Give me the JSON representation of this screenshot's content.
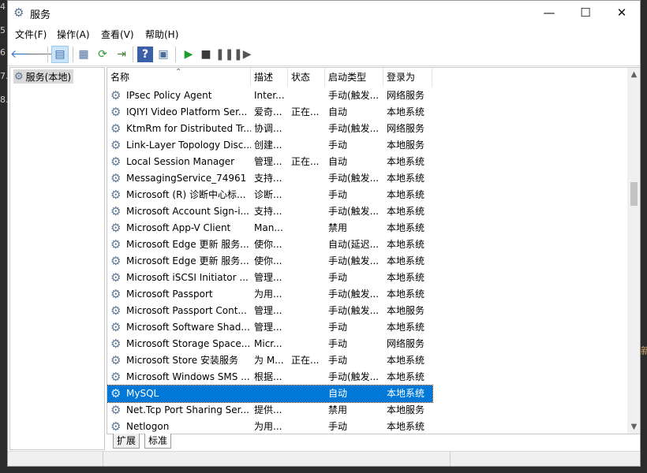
{
  "gutter": [
    "4",
    "5",
    "6",
    "7.",
    "8."
  ],
  "right_edge_char": "新",
  "window": {
    "title": "服务",
    "minimize": "—",
    "maximize": "☐",
    "close": "✕"
  },
  "menu": [
    "文件(F)",
    "操作(A)",
    "查看(V)",
    "帮助(H)"
  ],
  "tree": {
    "root_label": "服务(本地)"
  },
  "columns": [
    "名称",
    "描述",
    "状态",
    "启动类型",
    "登录为"
  ],
  "services": [
    {
      "name": "IPsec Policy Agent",
      "desc": "Inter...",
      "status": "",
      "startup": "手动(触发...",
      "logon": "网络服务"
    },
    {
      "name": "IQIYI Video Platform Ser...",
      "desc": "爱奇...",
      "status": "正在...",
      "startup": "自动",
      "logon": "本地系统"
    },
    {
      "name": "KtmRm for Distributed Tr...",
      "desc": "协调...",
      "status": "",
      "startup": "手动(触发...",
      "logon": "网络服务"
    },
    {
      "name": "Link-Layer Topology Disc...",
      "desc": "创建...",
      "status": "",
      "startup": "手动",
      "logon": "本地服务"
    },
    {
      "name": "Local Session Manager",
      "desc": "管理...",
      "status": "正在...",
      "startup": "自动",
      "logon": "本地系统"
    },
    {
      "name": "MessagingService_74961",
      "desc": "支持...",
      "status": "",
      "startup": "手动(触发...",
      "logon": "本地系统"
    },
    {
      "name": "Microsoft (R) 诊断中心标...",
      "desc": "诊断...",
      "status": "",
      "startup": "手动",
      "logon": "本地系统"
    },
    {
      "name": "Microsoft Account Sign-i...",
      "desc": "支持...",
      "status": "",
      "startup": "手动(触发...",
      "logon": "本地系统"
    },
    {
      "name": "Microsoft App-V Client",
      "desc": "Man...",
      "status": "",
      "startup": "禁用",
      "logon": "本地系统"
    },
    {
      "name": "Microsoft Edge 更新 服务...",
      "desc": "使你...",
      "status": "",
      "startup": "自动(延迟...",
      "logon": "本地系统"
    },
    {
      "name": "Microsoft Edge 更新 服务...",
      "desc": "使你...",
      "status": "",
      "startup": "手动(触发...",
      "logon": "本地系统"
    },
    {
      "name": "Microsoft iSCSI Initiator ...",
      "desc": "管理...",
      "status": "",
      "startup": "手动",
      "logon": "本地系统"
    },
    {
      "name": "Microsoft Passport",
      "desc": "为用...",
      "status": "",
      "startup": "手动(触发...",
      "logon": "本地系统"
    },
    {
      "name": "Microsoft Passport Cont...",
      "desc": "管理...",
      "status": "",
      "startup": "手动(触发...",
      "logon": "本地服务"
    },
    {
      "name": "Microsoft Software Shad...",
      "desc": "管理...",
      "status": "",
      "startup": "手动",
      "logon": "本地系统"
    },
    {
      "name": "Microsoft Storage Space...",
      "desc": "Micr...",
      "status": "",
      "startup": "手动",
      "logon": "网络服务"
    },
    {
      "name": "Microsoft Store 安装服务",
      "desc": "为 M...",
      "status": "正在...",
      "startup": "手动",
      "logon": "本地系统"
    },
    {
      "name": "Microsoft Windows SMS ...",
      "desc": "根据...",
      "status": "",
      "startup": "手动(触发...",
      "logon": "本地系统"
    },
    {
      "name": "MySQL",
      "desc": "",
      "status": "",
      "startup": "自动",
      "logon": "本地系统",
      "selected": true
    },
    {
      "name": "Net.Tcp Port Sharing Ser...",
      "desc": "提供...",
      "status": "",
      "startup": "禁用",
      "logon": "本地服务"
    },
    {
      "name": "Netlogon",
      "desc": "为用...",
      "status": "",
      "startup": "手动",
      "logon": "本地系统"
    }
  ],
  "tabs": [
    "扩展",
    "标准"
  ]
}
